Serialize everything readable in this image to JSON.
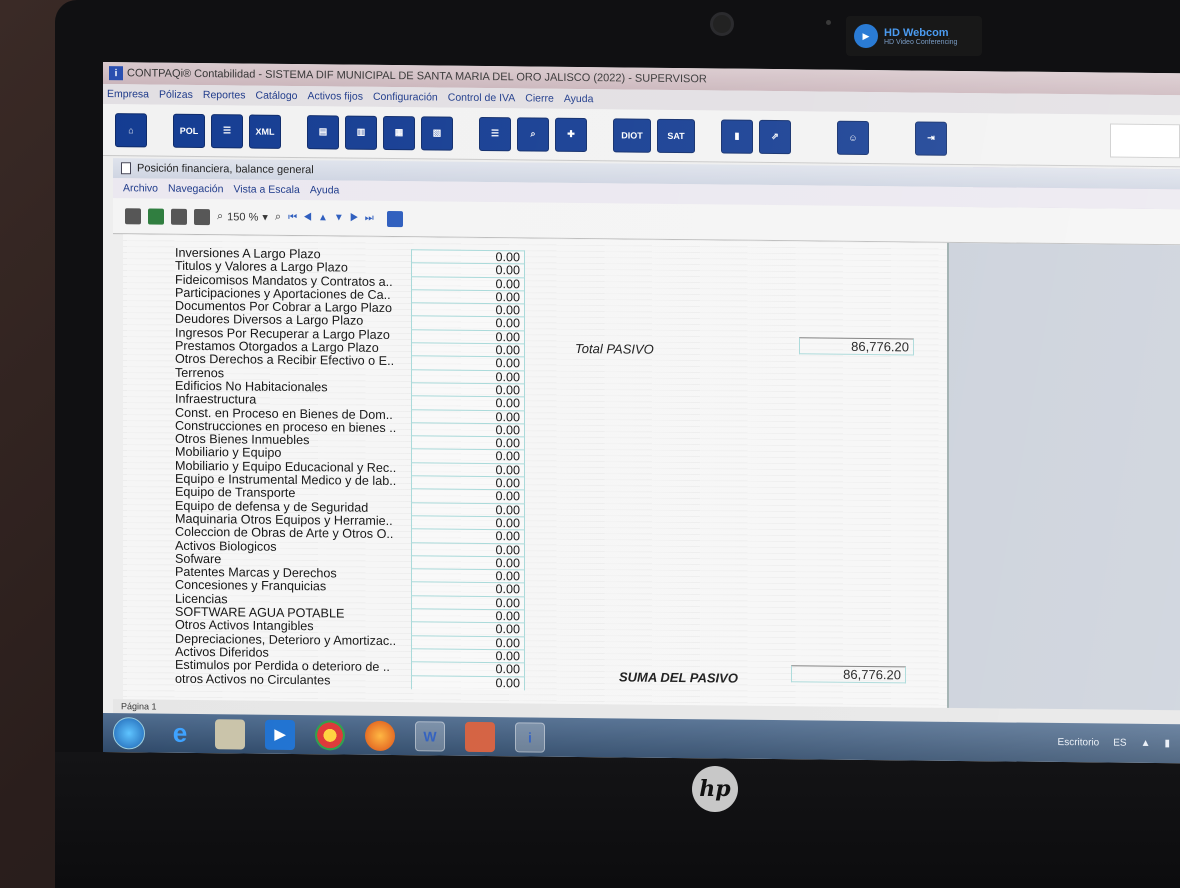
{
  "webcam": {
    "title": "HD Webcom",
    "subtitle": "HD Video Conferencing"
  },
  "window": {
    "title": "CONTPAQi® Contabilidad - SISTEMA DIF MUNICIPAL DE SANTA MARIA DEL ORO JALISCO (2022) - SUPERVISOR"
  },
  "menu": [
    "Empresa",
    "Pólizas",
    "Reportes",
    "Catálogo",
    "Activos fijos",
    "Configuración",
    "Control de IVA",
    "Cierre",
    "Ayuda"
  ],
  "toolbar": {
    "pol": "POL",
    "xml": "XML",
    "diot": "DIOT",
    "sat": "SAT"
  },
  "subwindow": {
    "title": "Posición financiera, balance general",
    "menu": [
      "Archivo",
      "Navegación",
      "Vista a Escala",
      "Ayuda"
    ],
    "zoom": "150 %",
    "status": "Página 1"
  },
  "report": {
    "rows": [
      {
        "label": "Inversiones A Largo Plazo",
        "value": "0.00"
      },
      {
        "label": "Titulos y Valores a Largo Plazo",
        "value": "0.00"
      },
      {
        "label": "Fideicomisos Mandatos y Contratos a..",
        "value": "0.00"
      },
      {
        "label": "Participaciones y Aportaciones de  Ca..",
        "value": "0.00"
      },
      {
        "label": "Documentos  Por Cobrar a Largo Plazo",
        "value": "0.00"
      },
      {
        "label": "Deudores Diversos a Largo Plazo",
        "value": "0.00"
      },
      {
        "label": "Ingresos Por  Recuperar a Largo Plazo",
        "value": "0.00"
      },
      {
        "label": "Prestamos Otorgados a Largo Plazo",
        "value": "0.00"
      },
      {
        "label": "Otros Derechos a Recibir Efectivo o E..",
        "value": "0.00"
      },
      {
        "label": "Terrenos",
        "value": "0.00"
      },
      {
        "label": "Edificios No Habitacionales",
        "value": "0.00"
      },
      {
        "label": "Infraestructura",
        "value": "0.00"
      },
      {
        "label": "Const. en Proceso en Bienes de Dom..",
        "value": "0.00"
      },
      {
        "label": "Construcciones en proceso en bienes ..",
        "value": "0.00"
      },
      {
        "label": "Otros Bienes Inmuebles",
        "value": "0.00"
      },
      {
        "label": "Mobiliario y Equipo",
        "value": "0.00"
      },
      {
        "label": "Mobiliario y Equipo Educacional y Rec..",
        "value": "0.00"
      },
      {
        "label": "Equipo e Instrumental Medico y de lab..",
        "value": "0.00"
      },
      {
        "label": "Equipo de Transporte",
        "value": "0.00"
      },
      {
        "label": "Equipo de defensa y de Seguridad",
        "value": "0.00"
      },
      {
        "label": "Maquinaria Otros Equipos y Herramie..",
        "value": "0.00"
      },
      {
        "label": "Coleccion de Obras de Arte y Otros O..",
        "value": "0.00"
      },
      {
        "label": "Activos  Biologicos",
        "value": "0.00"
      },
      {
        "label": "Sofware",
        "value": "0.00"
      },
      {
        "label": "Patentes Marcas y Derechos",
        "value": "0.00"
      },
      {
        "label": "Concesiones y Franquicias",
        "value": "0.00"
      },
      {
        "label": "Licencias",
        "value": "0.00"
      },
      {
        "label": "SOFTWARE AGUA POTABLE",
        "value": "0.00"
      },
      {
        "label": "Otros Activos Intangibles",
        "value": "0.00"
      },
      {
        "label": "Depreciaciones, Deterioro y Amortizac..",
        "value": "0.00"
      },
      {
        "label": "Activos Diferidos",
        "value": "0.00"
      },
      {
        "label": "Estimulos por Perdida o deterioro de ..",
        "value": "0.00"
      },
      {
        "label": "otros Activos no Circulantes",
        "value": "0.00"
      }
    ],
    "total_pasivo_label": "Total PASIVO",
    "total_pasivo_value": "86,776.20",
    "suma_pasivo_label": "SUMA DEL PASIVO",
    "suma_pasivo_value": "86,776.20"
  },
  "taskbar": {
    "desktop": "Escritorio",
    "lang": "ES"
  },
  "bezel": {
    "brand": "hp"
  }
}
